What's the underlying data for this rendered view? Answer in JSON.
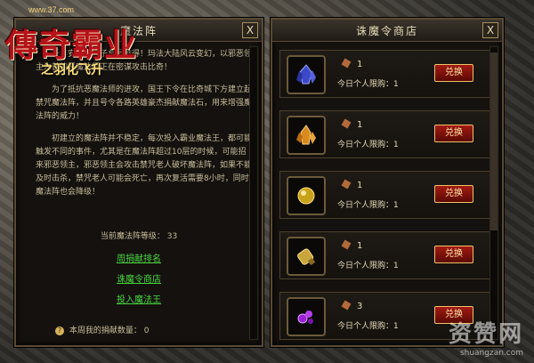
{
  "logo": {
    "site": "www.37.com",
    "main": "傳奇霸业",
    "sub": "之羽化飞升"
  },
  "left_panel": {
    "title": "魔法阵",
    "close": "X",
    "story": [
      "千年安详的日子总是难得！玛法大陆风云变幻，以邪恶领主为首的恶魔法师正在密谋攻击比奇！",
      "为了抵抗恶魔法师的进攻，国王下令在比奇城下方建立起禁咒魔法阵，并且号令各路英雄豪杰捐献魔法石，用来增强魔法阵的威力！",
      "初建立的魔法阵并不稳定，每次投入霸业魔法王，都可能触发不同的事件，尤其是在魔法阵超过10层的时候，可能招来邪恶领主，邪恶领主会攻击禁咒老人破坏魔法阵，如果不能及时击杀，禁咒老人可能会死亡，再次复活需要8小时，同时魔法阵也会降级！"
    ],
    "level_label": "当前魔法阵等级：",
    "level_value": "33",
    "links": [
      "周捐献排名",
      "诛魔令商店",
      "投入魔法王"
    ],
    "donate_label": "本周我的捐献数量：",
    "donate_value": "0"
  },
  "right_panel": {
    "title": "诛魔令商店",
    "close": "X",
    "items": [
      {
        "cost": "1",
        "limit_label": "今日个人限购：",
        "limit": "1",
        "button": "兑换",
        "icon": "blue-crystal-icon",
        "color": "#3b49c9"
      },
      {
        "cost": "1",
        "limit_label": "今日个人限购：",
        "limit": "1",
        "button": "兑换",
        "icon": "gold-crystal-icon",
        "color": "#d98a1c"
      },
      {
        "cost": "1",
        "limit_label": "今日个人限购：",
        "limit": "1",
        "button": "兑换",
        "icon": "gold-nugget-icon",
        "color": "#c9a21c"
      },
      {
        "cost": "1",
        "limit_label": "今日个人限购：",
        "limit": "1",
        "button": "兑换",
        "icon": "gold-scroll-icon",
        "color": "#c7a53a"
      },
      {
        "cost": "3",
        "limit_label": "今日个人限购：",
        "limit": "1",
        "button": "兑换",
        "icon": "purple-gem-icon",
        "color": "#9b1fd6"
      }
    ]
  },
  "watermark": {
    "text": "资赞网",
    "url": "shuangzan.com"
  }
}
